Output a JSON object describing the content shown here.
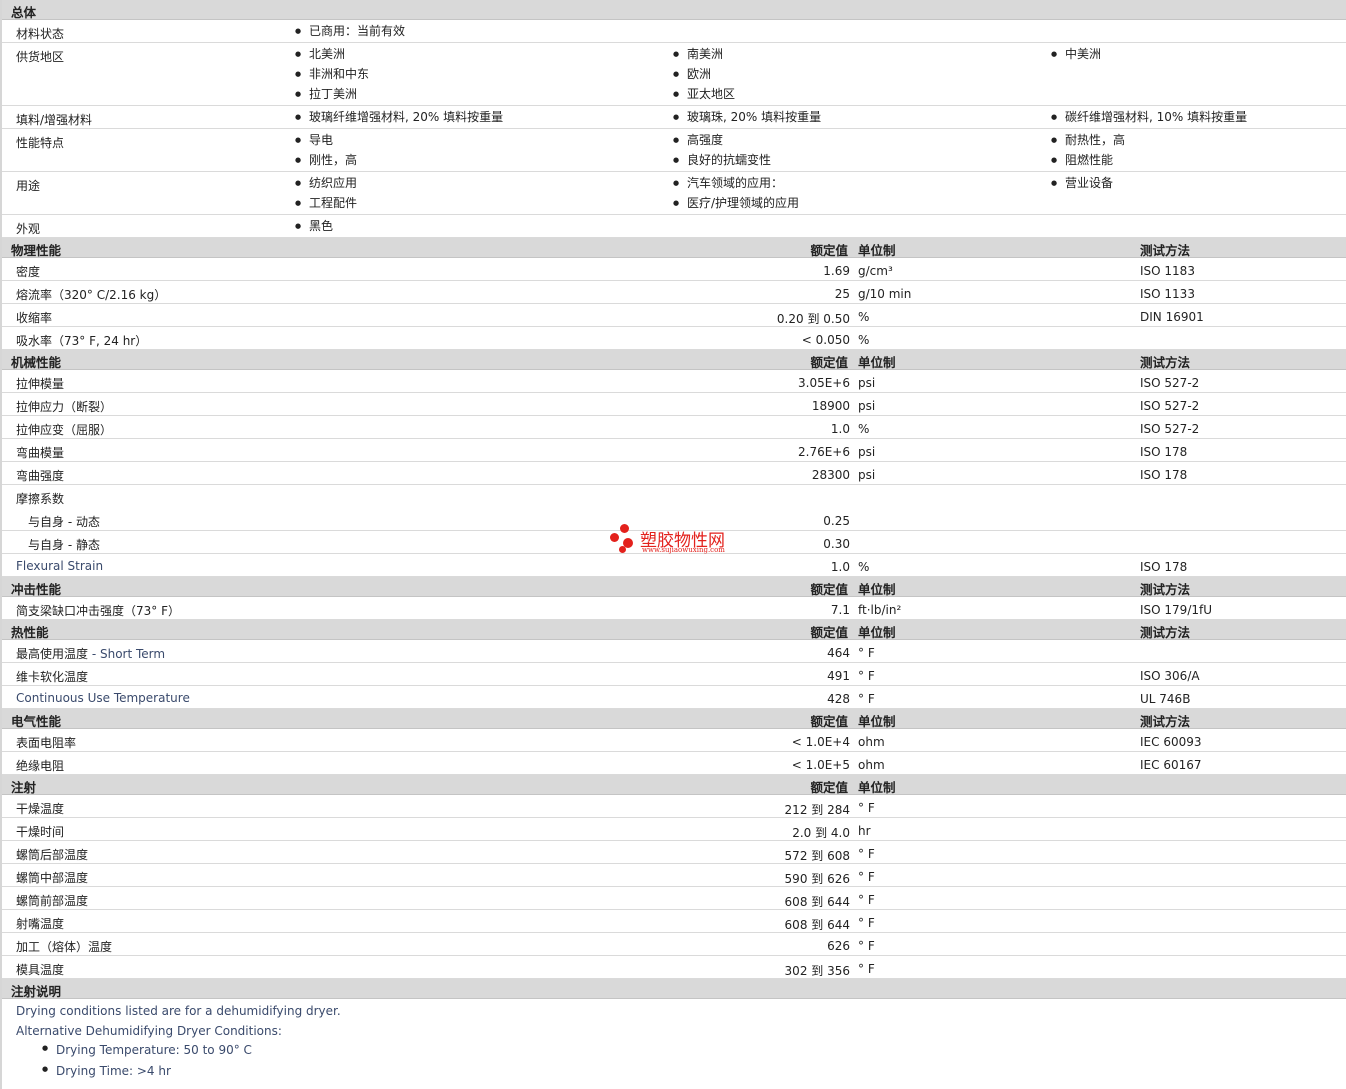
{
  "general": {
    "title": "总体",
    "rows": [
      {
        "label": "材料状态",
        "cols": [
          [
            "已商用：当前有效"
          ],
          [],
          []
        ]
      },
      {
        "label": "供货地区",
        "cols": [
          [
            "北美洲",
            "非洲和中东",
            "拉丁美洲"
          ],
          [
            "南美洲",
            "欧洲",
            "亚太地区"
          ],
          [
            "中美洲"
          ]
        ]
      },
      {
        "label": "填料/增强材料",
        "cols": [
          [
            "玻璃纤维增强材料, 20% 填料按重量"
          ],
          [
            "玻璃珠, 20% 填料按重量"
          ],
          [
            "碳纤维增强材料, 10% 填料按重量"
          ]
        ]
      },
      {
        "label": "性能特点",
        "cols": [
          [
            "导电",
            "刚性，高"
          ],
          [
            "高强度",
            "良好的抗蠕变性"
          ],
          [
            "耐热性，高",
            "阻燃性能"
          ]
        ]
      },
      {
        "label": "用途",
        "cols": [
          [
            "纺织应用",
            "工程配件"
          ],
          [
            "汽车领域的应用：",
            "医疗/护理领域的应用"
          ],
          [
            "营业设备"
          ]
        ]
      },
      {
        "label": "外观",
        "cols": [
          [
            "黑色"
          ],
          [],
          []
        ]
      }
    ]
  },
  "headers": {
    "value": "额定值",
    "unit": "单位制",
    "method": "测试方法"
  },
  "sections": [
    {
      "title": "物理性能",
      "method": true,
      "rows": [
        {
          "label": "密度",
          "value": "1.69",
          "unit": "g/cm³",
          "method": "ISO 1183"
        },
        {
          "label": "熔流率（320°  C/2.16 kg）",
          "value": "25",
          "unit": "g/10 min",
          "method": "ISO 1133"
        },
        {
          "label": "收缩率",
          "value": "0.20 到  0.50",
          "unit": "%",
          "method": "DIN 16901"
        },
        {
          "label": "吸水率（73°  F, 24 hr）",
          "value": "< 0.050",
          "unit": "%",
          "method": ""
        }
      ]
    },
    {
      "title": "机械性能",
      "method": true,
      "rows": [
        {
          "label": "拉伸模量",
          "value": "3.05E+6",
          "unit": "psi",
          "method": "ISO 527-2"
        },
        {
          "label": "拉伸应力（断裂）",
          "value": "18900",
          "unit": "psi",
          "method": "ISO 527-2"
        },
        {
          "label": "拉伸应变（屈服）",
          "value": "1.0",
          "unit": "%",
          "method": "ISO 527-2"
        },
        {
          "label": "弯曲模量",
          "value": "2.76E+6",
          "unit": "psi",
          "method": "ISO 178"
        },
        {
          "label": "弯曲强度",
          "value": "28300",
          "unit": "psi",
          "method": "ISO 178"
        },
        {
          "label": "摩擦系数",
          "value": "",
          "unit": "",
          "method": "",
          "nob": true
        },
        {
          "label": "与自身  - 动态",
          "value": "0.25",
          "unit": "",
          "method": "",
          "indent": true
        },
        {
          "label": "与自身  - 静态",
          "value": "0.30",
          "unit": "",
          "method": "",
          "indent": true
        },
        {
          "label": "Flexural Strain",
          "value": "1.0",
          "unit": "%",
          "method": "ISO 178",
          "en": true
        }
      ]
    },
    {
      "title": "冲击性能",
      "method": true,
      "rows": [
        {
          "label": "简支梁缺口冲击强度（73°  F）",
          "value": "7.1",
          "unit": "ft·lb/in²",
          "method": "ISO 179/1fU"
        }
      ]
    },
    {
      "title": "热性能",
      "method": true,
      "rows": [
        {
          "label": "最高使用温度",
          "label_en": " - Short Term",
          "value": "464",
          "unit": "°  F",
          "method": ""
        },
        {
          "label": "维卡软化温度",
          "value": "491",
          "unit": "°  F",
          "method": "ISO 306/A"
        },
        {
          "label": "Continuous Use Temperature",
          "value": "428",
          "unit": "°  F",
          "method": "UL 746B",
          "en": true
        }
      ]
    },
    {
      "title": "电气性能",
      "method": true,
      "rows": [
        {
          "label": "表面电阻率",
          "value": "< 1.0E+4",
          "unit": "ohm",
          "method": "IEC 60093"
        },
        {
          "label": "绝缘电阻",
          "value": "< 1.0E+5",
          "unit": "ohm",
          "method": "IEC 60167"
        }
      ]
    },
    {
      "title": "注射",
      "method": false,
      "rows": [
        {
          "label": "干燥温度",
          "value": "212 到  284",
          "unit": "°  F",
          "method": ""
        },
        {
          "label": "干燥时间",
          "value": "2.0 到  4.0",
          "unit": "hr",
          "method": ""
        },
        {
          "label": "螺筒后部温度",
          "value": "572 到  608",
          "unit": "°  F",
          "method": ""
        },
        {
          "label": "螺筒中部温度",
          "value": "590 到  626",
          "unit": "°  F",
          "method": ""
        },
        {
          "label": "螺筒前部温度",
          "value": "608 到  644",
          "unit": "°  F",
          "method": ""
        },
        {
          "label": "射嘴温度",
          "value": "608 到  644",
          "unit": "°  F",
          "method": ""
        },
        {
          "label": "加工（熔体）温度",
          "value": "626",
          "unit": "°  F",
          "method": ""
        },
        {
          "label": "模具温度",
          "value": "302 到  356",
          "unit": "°  F",
          "method": ""
        }
      ]
    }
  ],
  "notes": {
    "title": "注射说明",
    "line1": "Drying conditions listed are for a dehumidifying dryer.",
    "line2": "Alternative Dehumidifying Dryer Conditions:",
    "bullet1": "Drying Temperature: 50 to 90°  C",
    "bullet2": "Drying Time: >4 hr"
  },
  "watermark": {
    "text": "塑胶物性网",
    "url": "www.sujiaowuxing.com",
    "color": "#e3211c"
  }
}
